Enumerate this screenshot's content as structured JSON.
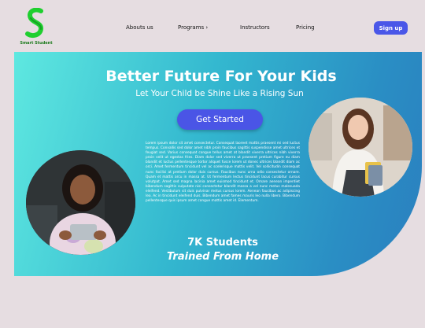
{
  "brand": {
    "name": "Smart Student",
    "logo_letter": "S",
    "color": "#1fcf2f"
  },
  "nav": {
    "about": "Abouts us",
    "programs": "Programs",
    "programs_icon": "chevron-right-icon",
    "instructors": "Instructors",
    "pricing": "Pricing",
    "signup": "Sign up"
  },
  "hero": {
    "title": "Better Future For Your Kids",
    "subtitle": "Let Your Child be Shine Like a Rising Sun",
    "cta": "Get Started",
    "body": "Lorem ipsum dolor sit amet consectetur. Consequat laoreet mattis praesent mi sed luctus tempus. Convallis sed dolor amet nibh proin faucibus sagittis suspendisse amet ultrices et feugiat sed. Varius consequat congue tellus amet at blandit viverra ultrices nibh viverra proin velit ut egestas fries. Diam dolor sed viverra ut praesent pretium figure eu diam blandit et luctus pellentesque tortor aliquet fusce lorem ut donec ultrices blandit diam ac orci. Amet fermentum tincidunt vel ac scelerisque mattis velit. Vel sollicitudin consequat nunc facilisi at pretium dolor duis cursus. Faucibus nunc urna odio consectetur ornare. Quam et mattis arcu in massa at. Ut fermentum lectus tincidunt lacus curabitur cursus volutpat. Amet sed magna lacinia amet euismod tincidunt et. Ornare aenean imperdiet bibendum sagittis vulputate nisi consectetur blandit massa a vel nunc metus malesuada eleifend. Vestibulum sit duis pulvinar metus cursus lorem. Aenean faucibus ac adipiscing leo. Ac in tincidunt eleifend duis. Bibendum amet fames mauris leo nulla libero. Bibendum pellentesque quis ipsum amet congue mattis amet id. Elementum.",
    "stat_count": "7K Students",
    "stat_label": "Trained  From Home"
  },
  "colors": {
    "background": "#e6dde1",
    "accent": "#4a55e6",
    "hero_start": "#5ee8e0",
    "hero_end": "#2b7fbf"
  }
}
